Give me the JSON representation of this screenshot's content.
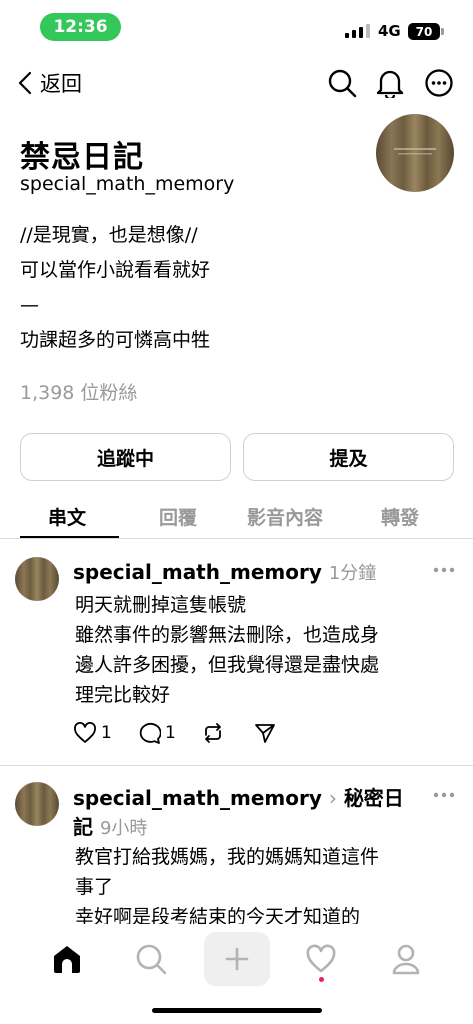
{
  "status_bar": {
    "time": "12:36",
    "network": "4G",
    "battery": "70"
  },
  "nav": {
    "back_label": "返回"
  },
  "profile": {
    "name": "禁忌日記",
    "handle": "special_math_memory",
    "bio": [
      "//是現實，也是想像//",
      "可以當作小說看看就好",
      "—",
      "功課超多的可憐高中牲"
    ],
    "followers": "1,398 位粉絲"
  },
  "buttons": {
    "following": "追蹤中",
    "mention": "提及"
  },
  "tabs": [
    "串文",
    "回覆",
    "影音內容",
    "轉發"
  ],
  "posts": [
    {
      "author": "special_math_memory",
      "time": "1分鐘",
      "lines": [
        "明天就刪掉這隻帳號",
        "雖然事件的影響無法刪除，也造成身",
        "邊人許多困擾，但我覺得還是盡快處",
        "理完比較好"
      ],
      "likes": "1",
      "comments": "1"
    },
    {
      "author": "special_math_memory",
      "tag_line1": "秘密日",
      "tag_line2": "記",
      "time": "9小時",
      "lines": [
        "教官打給我媽媽，我的媽媽知道這件",
        "事了",
        "幸好啊是段考結束的今天才知道的"
      ]
    }
  ],
  "icons": {
    "back": "chevron-left-icon",
    "search": "search-icon",
    "bell": "bell-icon",
    "more": "more-icon",
    "heart": "heart-icon",
    "comment": "comment-icon",
    "repost": "repost-icon",
    "share": "send-icon",
    "home": "home-icon",
    "create": "plus-icon",
    "activity": "heart-icon",
    "profile": "person-icon"
  },
  "colors": {
    "status_green": "#34c759",
    "muted": "#999999",
    "notification": "#e0245e"
  }
}
